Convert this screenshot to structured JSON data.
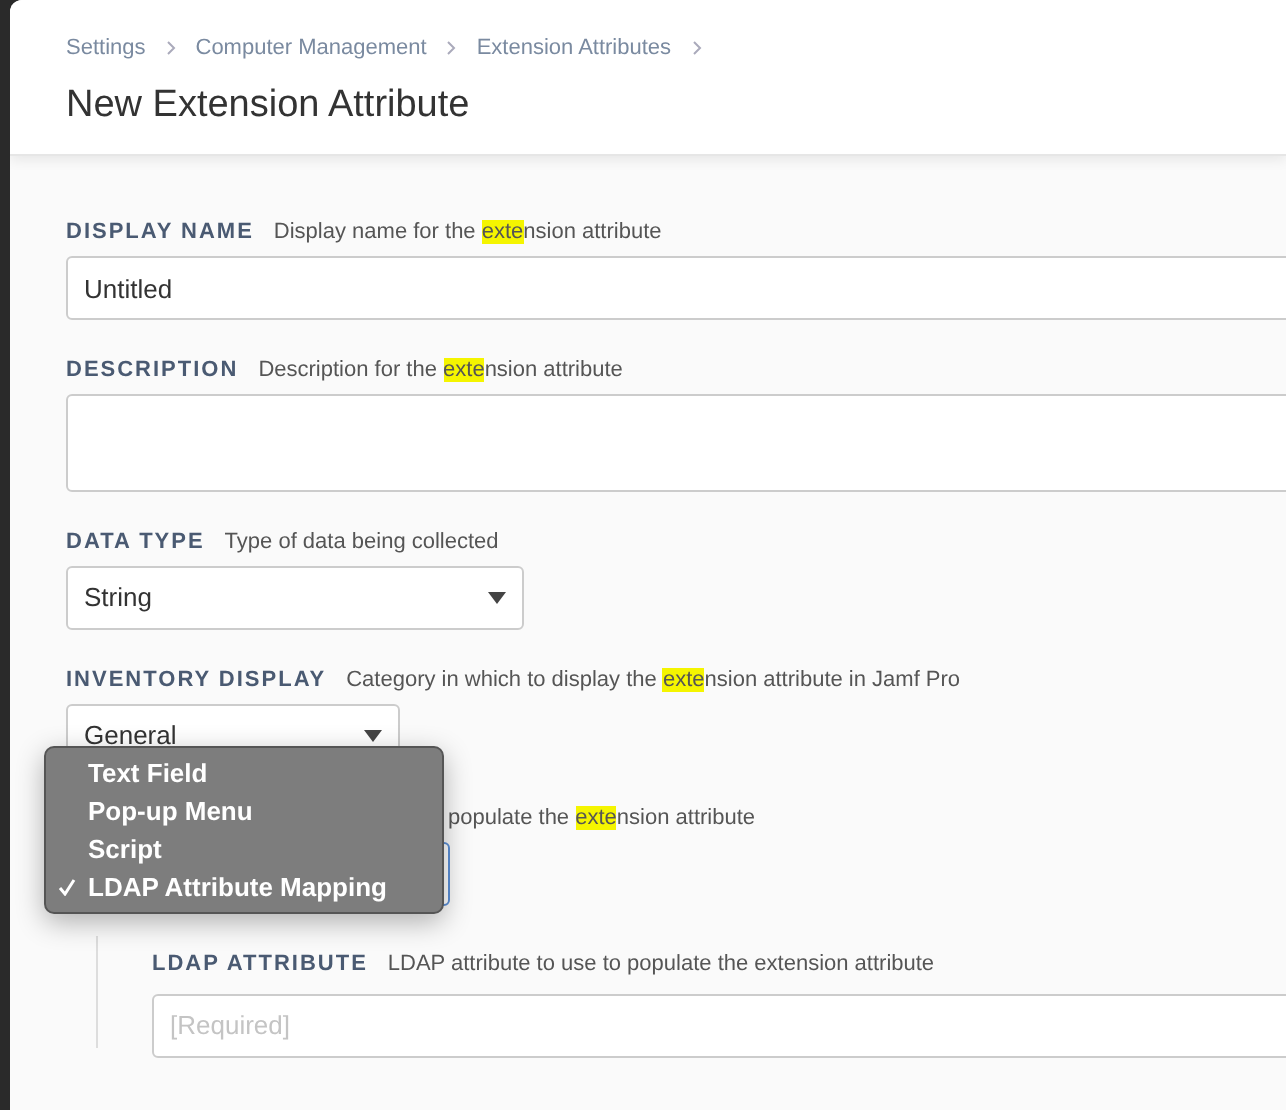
{
  "breadcrumbs": [
    "Settings",
    "Computer Management",
    "Extension Attributes"
  ],
  "title": "New Extension Attribute",
  "fields": [
    {
      "kind": "text",
      "label": "DISPLAY NAME",
      "description": [
        {
          "text": "Display name for the ",
          "highlighted": false
        },
        {
          "text": "exte",
          "highlighted": true
        },
        {
          "text": "nsion attribute",
          "highlighted": false
        }
      ],
      "value": "Untitled"
    },
    {
      "kind": "textarea",
      "label": "DESCRIPTION",
      "description": [
        {
          "text": "Description for the ",
          "highlighted": false
        },
        {
          "text": "exte",
          "highlighted": true
        },
        {
          "text": "nsion attribute",
          "highlighted": false
        }
      ]
    },
    {
      "kind": "select",
      "label": "DATA TYPE",
      "description": [
        {
          "text": "Type of data being collected",
          "highlighted": false
        }
      ],
      "value": "String",
      "focused": false
    },
    {
      "kind": "select",
      "label": "INVENTORY DISPLAY",
      "description": [
        {
          "text": "Category in which to display the ",
          "highlighted": false
        },
        {
          "text": "exte",
          "highlighted": true
        },
        {
          "text": "nsion attribute in Jamf Pro",
          "highlighted": false
        }
      ],
      "value": "General",
      "focused": false
    },
    {
      "kind": "select",
      "description": [
        {
          "text": "populate the ",
          "highlighted": false
        },
        {
          "text": "exte",
          "highlighted": true
        },
        {
          "text": "nsion attribute",
          "highlighted": false
        }
      ],
      "focused": true
    }
  ],
  "menu": [
    {
      "label": "Text Field",
      "selected": false
    },
    {
      "label": "Pop-up Menu",
      "selected": false
    },
    {
      "label": "Script",
      "selected": false
    },
    {
      "label": "LDAP Attribute Mapping",
      "selected": true
    }
  ],
  "ldap": {
    "label": "LDAP ATTRIBUTE",
    "description": "LDAP attribute to use to populate the extension attribute",
    "placeholder": "[Required]"
  }
}
